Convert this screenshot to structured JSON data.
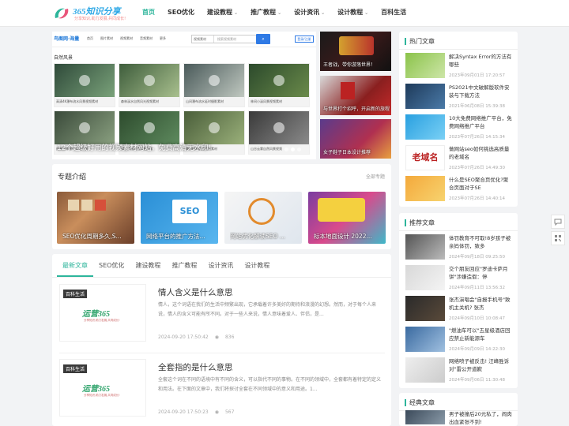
{
  "site": {
    "logo_name": "365知识分享",
    "logo_slogan": "分享知识,助力发展,共同成长!",
    "brand_color": "#2db59b"
  },
  "nav": [
    {
      "label": "首页",
      "active": true,
      "dropdown": false
    },
    {
      "label": "SEO优化",
      "active": false,
      "dropdown": false
    },
    {
      "label": "建设教程",
      "active": false,
      "dropdown": true
    },
    {
      "label": "推广教程",
      "active": false,
      "dropdown": true
    },
    {
      "label": "设计资讯",
      "active": false,
      "dropdown": true
    },
    {
      "label": "设计教程",
      "active": false,
      "dropdown": true
    },
    {
      "label": "百科生活",
      "active": false,
      "dropdown": false
    }
  ],
  "slider": {
    "embedded_logo": "鸟图网·海量",
    "embedded_menu": [
      "首页",
      "图片素材",
      "视频素材",
      "音频素材",
      "更多"
    ],
    "search_select": "视频素材",
    "search_placeholder": "搜索视频素材",
    "login": "登录/注册",
    "category": "自然风景",
    "tiles": [
      "高清4K瀑布流水风景视频素材",
      "森林溪水自然风光视频素材",
      "山间瀑布流水延时摄影素材",
      "林间小溪风景视频素材",
      "热带雨林瀑布风光视频",
      "绿色竹林自然风景视频",
      "森林树木航拍视频素材",
      "山谷云雾自然风景视频"
    ],
    "title": "12个超级好用的视频素材网站，免费高清无水印!"
  },
  "side_ads": [
    {
      "caption": "王者战，带你游荡世界！"
    },
    {
      "caption": "与世界打个招呼，开启新的旅程"
    },
    {
      "caption": "女子鞋子日本设计推荐"
    }
  ],
  "topics": {
    "title": "专题介绍",
    "more": "全部专题",
    "items": [
      {
        "caption": "SEO优化周期多久,S..."
      },
      {
        "caption": "网络平台的推广方法..."
      },
      {
        "caption": "网站优化解读SEO ..."
      },
      {
        "caption": "标本地面设计 2022..."
      }
    ]
  },
  "articles": {
    "tabs": [
      "最新文章",
      "SEO优化",
      "建设教程",
      "推广教程",
      "设计资讯",
      "设计教程"
    ],
    "active_tab": 0,
    "posts": [
      {
        "badge": "百科生活",
        "thumb_logo": "运营365",
        "thumb_sub": "分享知识,助力发展,共同成长!",
        "title": "情人含义是什么意思",
        "excerpt": "情人，这个词语在我们的生活中频繁出现，它承载着许多美好的期待和浪漫的幻想。然而，对于每个人来说，情人的含义可能有所不同。对于一些人来说，情人意味着爱人、伴侣，是...",
        "date": "2024-09-20 17:50:42",
        "views": "836"
      },
      {
        "badge": "百科生活",
        "thumb_logo": "运营365",
        "thumb_sub": "分享知识,助力发展,共同成长!",
        "title": "全套指的是什么意思",
        "excerpt": "全套这个词在不同的语境中有不同的含义，可以指代不同的事物。在不同的领域中，全套都有着特定的定义和用法。在下面的文章中，我们将探讨全套在不同领域中的意义和用途。1...",
        "date": "2024-09-20 17:50:23",
        "views": "567"
      }
    ]
  },
  "hot": {
    "title": "热门文章",
    "items": [
      {
        "title": "解决Syntax Error的方法有哪些",
        "date": "2023年09月01日 17:20:57"
      },
      {
        "title": "PS2021中文破解版软件安装与下载方法",
        "date": "2021年06月08日 15:39:38"
      },
      {
        "title": "10大免费网络推广平台，免费网络推广平台",
        "date": "2023年07月26日 14:15:34"
      },
      {
        "title": "做网站seo如何挑选高质量的老域名",
        "date": "2023年07月26日 14:49:30"
      },
      {
        "title": "什么是SEO聚合页优化?聚合页面对于SE",
        "date": "2023年07月26日 14:40:14"
      }
    ]
  },
  "recommend": {
    "title": "推荐文章",
    "items": [
      {
        "title": "体罚教育不可取!8岁孩子被亲妈体罚，致多",
        "date": "2024年09月18日 09:25:50"
      },
      {
        "title": "交个朋友回应\"罗迪卡萨月饼\"涉嫌造假：停",
        "date": "2024年09月11日 13:56:32"
      },
      {
        "title": "张杰演唱会\"自报手机号\"致机主关机? 张杰",
        "date": "2024年09月10日 10:08:47"
      },
      {
        "title": "\"燃油车可以\"五星级酒店回应禁止新能源车",
        "date": "2024年09月09日 14:22:30"
      },
      {
        "title": "网络喷子被反击! 汪峰胜诉 对\"雷公开道歉",
        "date": "2024年09月06日 11:30:48"
      }
    ]
  },
  "classic": {
    "title": "经典文章",
    "items": [
      {
        "title": "男子被撞后20元私了，闹肉出血紧张不到!",
        "date": ""
      }
    ]
  },
  "icons": {
    "float_1": "chat-icon",
    "float_2": "qrcode-icon"
  }
}
